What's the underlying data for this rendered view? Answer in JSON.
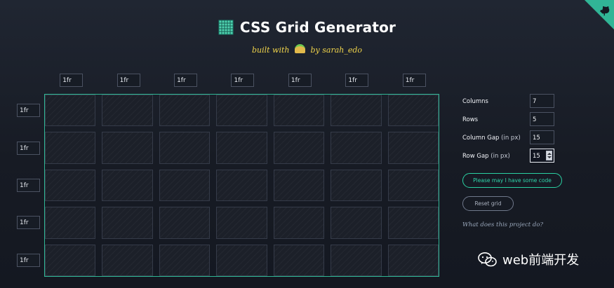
{
  "header": {
    "title": "CSS Grid Generator",
    "subtitle_prefix": "built with",
    "subtitle_suffix": "by sarah_edo",
    "subtitle_icon": "taco-icon",
    "title_icon": "grid-icon"
  },
  "corner_ribbon": {
    "icon": "github-cat-icon",
    "color": "#31b596"
  },
  "column_tracks": [
    {
      "value": "1fr"
    },
    {
      "value": "1fr"
    },
    {
      "value": "1fr"
    },
    {
      "value": "1fr"
    },
    {
      "value": "1fr"
    },
    {
      "value": "1fr"
    },
    {
      "value": "1fr"
    }
  ],
  "row_tracks": [
    {
      "value": "1fr"
    },
    {
      "value": "1fr"
    },
    {
      "value": "1fr"
    },
    {
      "value": "1fr"
    },
    {
      "value": "1fr"
    }
  ],
  "controls": {
    "columns": {
      "label": "Columns",
      "value": "7"
    },
    "rows": {
      "label": "Rows",
      "value": "5"
    },
    "column_gap": {
      "label": "Column Gap",
      "hint": "(in px)",
      "value": "15"
    },
    "row_gap": {
      "label": "Row Gap",
      "hint": "(in px)",
      "value": "15"
    }
  },
  "actions": {
    "code_button": "Please may I have some code",
    "reset_button": "Reset grid",
    "about_link": "What does this project do?"
  },
  "watermark": {
    "text": "web前端开发",
    "icon": "wechat-icon"
  },
  "colors": {
    "accent": "#2fb795",
    "background": "#171b24",
    "subtitle": "#f2d54b"
  }
}
